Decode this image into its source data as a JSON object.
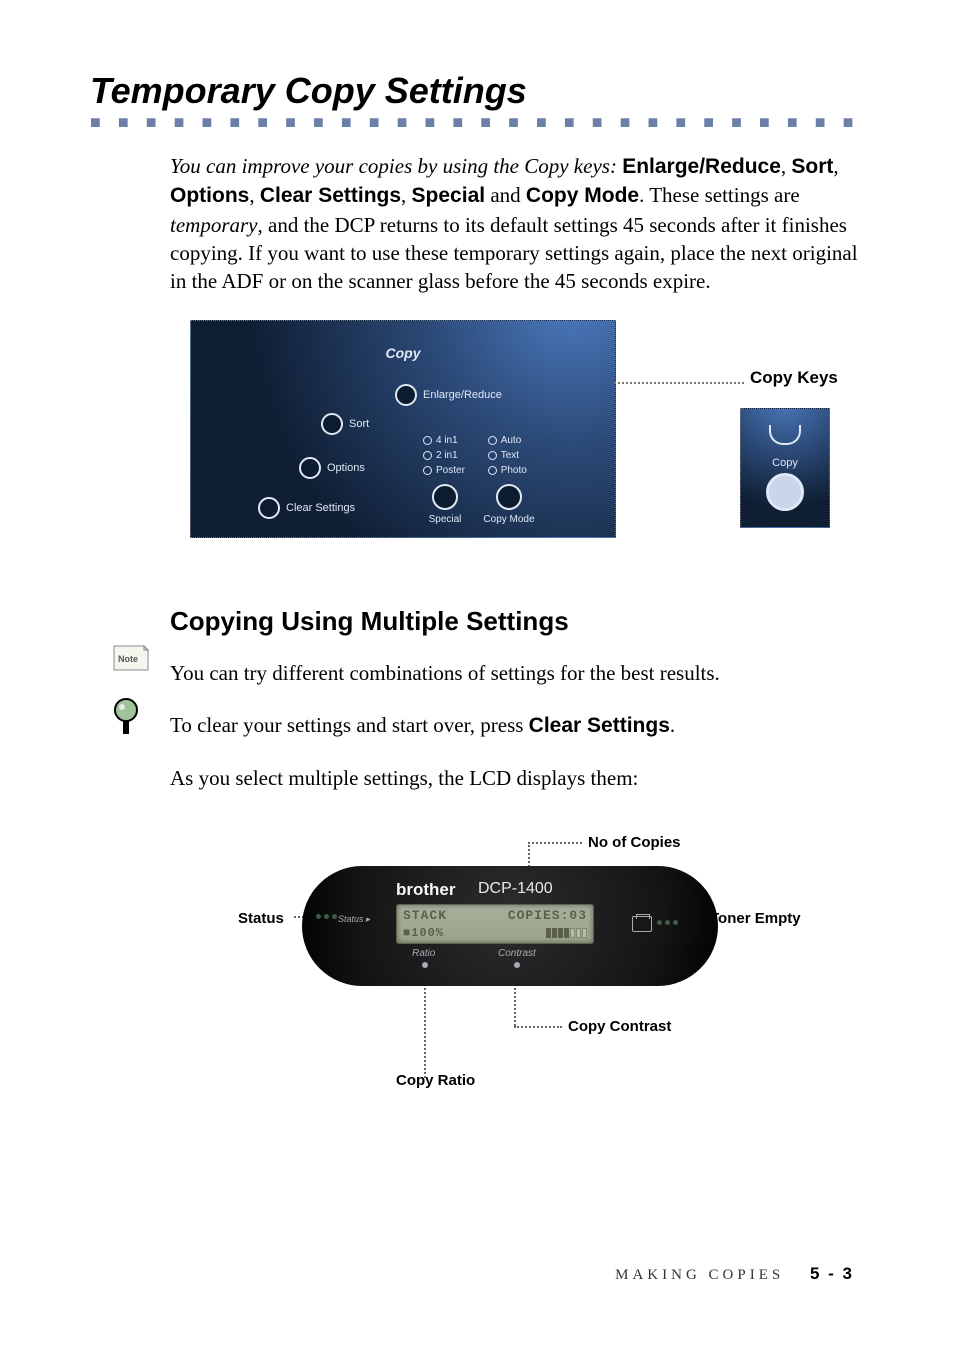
{
  "title": "Temporary Copy Settings",
  "intro": {
    "lead": "You can improve your copies by using the Copy keys:",
    "key1": "Enlarge/Reduce",
    "key2": "Sort",
    "key3": "Options",
    "key4": "Clear Settings",
    "key5": "Special",
    "keyAnd": " and ",
    "key6": "Copy Mode",
    "mid1": ". These settings are ",
    "temp": "temporary",
    "rest": ", and the DCP returns to its default settings 45 seconds after it finishes copying. If you want to use these temporary settings again, place the next original in the ADF or on the scanner glass before the 45 seconds expire."
  },
  "fig1": {
    "label": "Copy Keys",
    "panel_heading": "Copy",
    "buttons": {
      "enlarge_reduce": "Enlarge/Reduce",
      "sort": "Sort",
      "options": "Options",
      "clear_settings": "Clear Settings",
      "special": "Special",
      "copy_mode": "Copy Mode"
    },
    "modes_left": [
      "4 in1",
      "2 in1",
      "Poster"
    ],
    "modes_right": [
      "Auto",
      "Text",
      "Photo"
    ],
    "target_label": "Copy"
  },
  "section2": {
    "heading": "Copying Using Multiple Settings",
    "line1": "You can try different combinations of settings for the best results.",
    "line2a": "To clear your settings and start over, press ",
    "line2b": "Clear Settings",
    "line2c": ".",
    "line3": "As you select multiple settings, the LCD displays them:"
  },
  "fig2": {
    "brand": "brother",
    "model": "DCP-1400",
    "status_label": "Status",
    "screen": {
      "stack": "STACK",
      "copies": "COPIES:03",
      "ratio": "■100%"
    },
    "dial_ratio": "Ratio",
    "dial_contrast": "Contrast",
    "callouts": {
      "copies": "No of Copies",
      "status": "Status",
      "toner": "Toner Empty",
      "contrast": "Copy Contrast",
      "ratio": "Copy Ratio"
    }
  },
  "footer": {
    "section": "MAKING COPIES",
    "page": "5 - 3"
  },
  "note_text": "Note"
}
